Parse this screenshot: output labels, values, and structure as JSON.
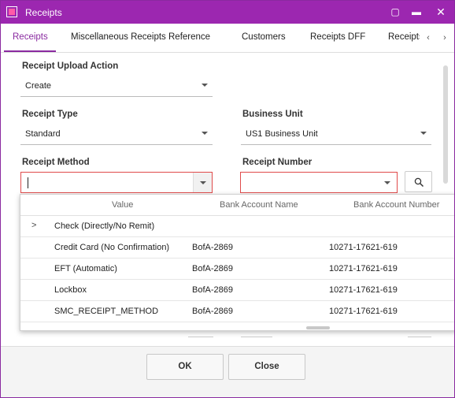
{
  "window": {
    "title": "Receipts",
    "accent_color": "#9c27b0"
  },
  "tabs": [
    {
      "label": "Receipts",
      "active": true
    },
    {
      "label": "Miscellaneous Receipts Reference"
    },
    {
      "label": "Customers"
    },
    {
      "label": "Receipts DFF"
    },
    {
      "label": "Receipts"
    }
  ],
  "form": {
    "upload_action": {
      "label": "Receipt Upload Action",
      "value": "Create"
    },
    "receipt_type": {
      "label": "Receipt Type",
      "value": "Standard"
    },
    "business_unit": {
      "label": "Business Unit",
      "value": "US1 Business Unit"
    },
    "receipt_method": {
      "label": "Receipt Method",
      "value": ""
    },
    "receipt_number": {
      "label": "Receipt Number",
      "value": ""
    }
  },
  "dropdown": {
    "columns": [
      "Value",
      "Bank Account Name",
      "Bank Account Number"
    ],
    "rows": [
      {
        "value": "Check (Directly/No Remit)",
        "bank_account_name": "",
        "bank_account_number": "",
        "expandable": true
      },
      {
        "value": "Credit Card (No Confirmation)",
        "bank_account_name": "BofA-2869",
        "bank_account_number": "10271-17621-619"
      },
      {
        "value": "EFT (Automatic)",
        "bank_account_name": "BofA-2869",
        "bank_account_number": "10271-17621-619"
      },
      {
        "value": "Lockbox",
        "bank_account_name": "BofA-2869",
        "bank_account_number": "10271-17621-619"
      },
      {
        "value": "SMC_RECEIPT_METHOD",
        "bank_account_name": "BofA-2869",
        "bank_account_number": "10271-17621-619"
      }
    ]
  },
  "buttons": {
    "ok": "OK",
    "close": "Close"
  }
}
